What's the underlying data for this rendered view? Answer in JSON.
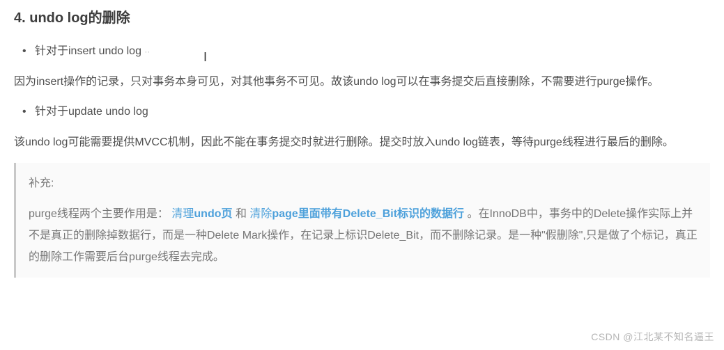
{
  "heading": "4. undo log的删除",
  "bullets": {
    "item1": "针对于insert undo log",
    "item2": "针对于update undo log"
  },
  "paragraphs": {
    "p1": "因为insert操作的记录，只对事务本身可见，对其他事务不可见。故该undo log可以在事务提交后直接删除，不需要进行purge操作。",
    "p2": "该undo log可能需要提供MVCC机制，因此不能在事务提交时就进行删除。提交时放入undo log链表，等待purge线程进行最后的删除。"
  },
  "note": {
    "title": "补充:",
    "prefix": "purge线程两个主要作用是： ",
    "hl1_a": "清理",
    "hl1_b": "undo页",
    "mid1": " 和 ",
    "hl2_a": "清除",
    "hl2_b": "page里面带有Delete_Bit标识的数据行",
    "mid2": " 。在InnoDB中，事务中的Delete操作实际上并不是真正的删除掉数据行，而是一种Delete Mark操作，在记录上标识Delete_Bit，而不删除记录。是一种\"假删除\",只是做了个标记，真正的删除工作需要后台purge线程去完成。"
  },
  "watermark": "CSDN @江北某不知名逼王"
}
